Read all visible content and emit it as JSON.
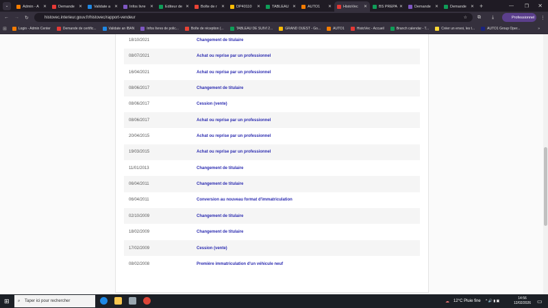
{
  "browser": {
    "tabs": [
      {
        "label": "Admin - A",
        "color": "#f57c00"
      },
      {
        "label": "Demande",
        "color": "#e53935"
      },
      {
        "label": "Validate a",
        "color": "#1e88e5"
      },
      {
        "label": "Infos livre",
        "color": "#7e57c2"
      },
      {
        "label": "Editeur de",
        "color": "#0f9d58"
      },
      {
        "label": "Boîte de r",
        "color": "#ea4335"
      },
      {
        "label": "DP40110",
        "color": "#fbbc04"
      },
      {
        "label": "TABLEAU",
        "color": "#0f9d58"
      },
      {
        "label": "AUTO1",
        "color": "#f57c00"
      },
      {
        "label": "HistoVec",
        "color": "#e53935",
        "active": true
      },
      {
        "label": "BS PREPA",
        "color": "#0f9d58"
      },
      {
        "label": "Demande",
        "color": "#7e57c2"
      },
      {
        "label": "Demande",
        "color": "#0f9d58"
      }
    ],
    "url": "histovec.interieur.gouv.fr/histovec/rapport-vendeur",
    "profile": "Professionnel",
    "bookmarks": [
      {
        "label": "Login - Admin Center",
        "color": "#f57c00"
      },
      {
        "label": "Demande de certific...",
        "color": "#e53935"
      },
      {
        "label": "Validate an IBAN",
        "color": "#1e88e5"
      },
      {
        "label": "Infos livres de polic...",
        "color": "#7e57c2"
      },
      {
        "label": "Boîte de réception (...",
        "color": "#ea4335"
      },
      {
        "label": "TABLEAU DE SUIVI 2...",
        "color": "#0f9d58"
      },
      {
        "label": "GRAND OUEST - Go...",
        "color": "#fbbc04"
      },
      {
        "label": "AUTO1",
        "color": "#f57c00"
      },
      {
        "label": "HistoVec - Accueil",
        "color": "#e53935"
      },
      {
        "label": "Branch calendar - T...",
        "color": "#0f9d58"
      },
      {
        "label": "Créer un envoi, les t...",
        "color": "#fdd835"
      },
      {
        "label": "AUTO1 Group Oper...",
        "color": "#1a237e"
      }
    ]
  },
  "history": [
    {
      "date": "18/10/2021",
      "event": "Changement de titulaire"
    },
    {
      "date": "08/07/2021",
      "event": "Achat ou reprise par un professionnel"
    },
    {
      "date": "16/04/2021",
      "event": "Achat ou reprise par un professionnel"
    },
    {
      "date": "08/06/2017",
      "event": "Changement de titulaire"
    },
    {
      "date": "08/06/2017",
      "event": "Cession (vente)"
    },
    {
      "date": "08/06/2017",
      "event": "Achat ou reprise par un professionnel"
    },
    {
      "date": "20/04/2015",
      "event": "Achat ou reprise par un professionnel"
    },
    {
      "date": "19/03/2015",
      "event": "Achat ou reprise par un professionnel"
    },
    {
      "date": "11/01/2013",
      "event": "Changement de titulaire"
    },
    {
      "date": "06/04/2011",
      "event": "Changement de titulaire"
    },
    {
      "date": "06/04/2011",
      "event": "Conversion au nouveau format d'immatriculation"
    },
    {
      "date": "02/10/2009",
      "event": "Changement de titulaire"
    },
    {
      "date": "18/02/2009",
      "event": "Changement de titulaire"
    },
    {
      "date": "17/02/2009",
      "event": "Cession (vente)"
    },
    {
      "date": "08/02/2008",
      "event": "Première immatriculation d'un véhicule neuf"
    }
  ],
  "taskbar": {
    "search_placeholder": "Taper ici pour rechercher",
    "weather": "12°C  Pluie fine",
    "time": "14:56",
    "date": "12/02/2026"
  }
}
